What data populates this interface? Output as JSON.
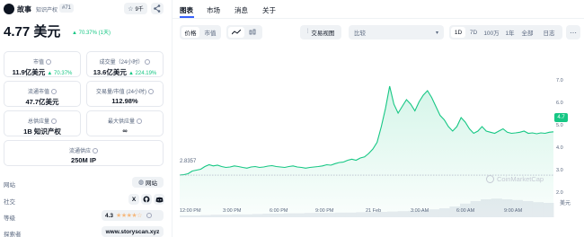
{
  "coin": {
    "name": "故事",
    "tag": "知识产权",
    "rank": "#71",
    "watch_count": "9千",
    "price": "4.77 美元",
    "change": "▲ 70.37% (1天)"
  },
  "stats": {
    "market_cap": {
      "label": "市值",
      "value": "11.9亿美元",
      "change": "▲ 70.37%"
    },
    "volume": {
      "label": "成交量（24小时）",
      "value": "13.6亿美元",
      "change": "▲ 224.19%"
    },
    "circulating_cap": {
      "label": "流通市值",
      "value": "47.7亿美元"
    },
    "vol_mcap": {
      "label": "交易量/市值 (24小时)",
      "value": "112.98%"
    },
    "total_supply": {
      "label": "总供应量",
      "value": "1B 知识产权"
    },
    "max_supply": {
      "label": "最大供应量",
      "value": "∞"
    },
    "circ_supply": {
      "label": "流通供应",
      "value": "250M IP"
    }
  },
  "links": {
    "website_label": "网站",
    "website_btn": "网站",
    "social_label": "社交",
    "rating_label": "等级",
    "rating_value": "4.3",
    "rating_stars": 4.3,
    "explorer_label": "探索者",
    "explorer_value": "www.storyscan.xyz"
  },
  "tabs": [
    "图表",
    "市场",
    "消息",
    "关于"
  ],
  "toolbar": {
    "price_btn": "价格",
    "mcap_btn": "市值",
    "compare_btn": "交易视图",
    "compare_select": "比较",
    "ranges": [
      "1D",
      "7D",
      "100万",
      "1年",
      "全部",
      "日志"
    ],
    "active_range": "1D"
  },
  "watermark": "CoinMarketCap",
  "price_marker": "4.7",
  "start_label": "2.8357",
  "unit_label": "美元",
  "chart_data": {
    "type": "area",
    "x_ticks": [
      "12:00 PM",
      "3:00 PM",
      "6:00 PM",
      "9:00 PM",
      "21 Feb",
      "3:00 AM",
      "6:00 AM",
      "9:00 AM"
    ],
    "y_ticks": [
      2.0,
      3.0,
      4.0,
      5.0,
      6.0,
      7.0
    ],
    "ylim": [
      1.6,
      7.6
    ],
    "start_price": 2.8357,
    "series": [
      {
        "values": [
          2.84,
          2.86,
          2.9,
          3.02,
          3.06,
          3.1,
          3.22,
          3.3,
          3.25,
          3.28,
          3.22,
          3.18,
          3.2,
          3.25,
          3.22,
          3.18,
          3.15,
          3.2,
          3.22,
          3.18,
          3.2,
          3.24,
          3.26,
          3.22,
          3.2,
          3.18,
          3.22,
          3.25,
          3.2,
          3.18,
          3.15,
          3.18,
          3.2,
          3.22,
          3.25,
          3.3,
          3.28,
          3.35,
          3.4,
          3.42,
          3.5,
          3.55,
          3.5,
          3.6,
          3.65,
          3.8,
          4.0,
          4.3,
          5.0,
          5.8,
          6.8,
          6.0,
          5.6,
          5.9,
          6.2,
          6.0,
          5.7,
          6.1,
          6.4,
          6.6,
          6.3,
          5.9,
          5.5,
          5.3,
          5.0,
          4.8,
          5.0,
          5.4,
          5.2,
          4.9,
          4.7,
          4.8,
          5.0,
          4.8,
          4.75,
          4.7,
          4.8,
          4.9,
          4.75,
          4.7,
          4.72,
          4.75,
          4.8,
          4.7,
          4.72,
          4.68,
          4.72,
          4.7,
          4.75,
          4.77
        ]
      }
    ],
    "volume": [
      0.05,
      0.05,
      0.06,
      0.07,
      0.07,
      0.08,
      0.08,
      0.09,
      0.1,
      0.1,
      0.11,
      0.11,
      0.12,
      0.12,
      0.12,
      0.13,
      0.13,
      0.14,
      0.14,
      0.15,
      0.16,
      0.17,
      0.18,
      0.2,
      0.22,
      0.25,
      0.3,
      0.38,
      0.45,
      0.5,
      0.52,
      0.5,
      0.48,
      0.45,
      0.42,
      0.4
    ]
  }
}
